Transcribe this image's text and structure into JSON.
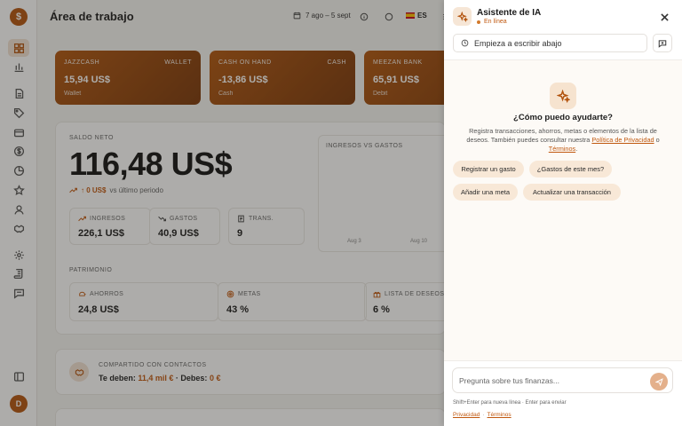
{
  "app": {
    "logo_glyph": "$",
    "page_title": "Área de trabajo",
    "user_initial": "D",
    "accent_color": "#b3540f"
  },
  "sidebar": {
    "items": [
      {
        "icon": "dashboard-icon",
        "active": true
      },
      {
        "icon": "bar-chart-icon"
      },
      {
        "icon": "document-icon"
      },
      {
        "icon": "tag-icon"
      },
      {
        "icon": "wallet-icon"
      },
      {
        "icon": "dollar-circle-icon"
      },
      {
        "icon": "pie-chart-icon"
      },
      {
        "icon": "star-icon"
      },
      {
        "icon": "user-icon"
      },
      {
        "icon": "handshake-icon"
      },
      {
        "icon": "settings-icon"
      },
      {
        "icon": "scroll-icon"
      },
      {
        "icon": "chat-icon"
      },
      {
        "icon": "collapse-sidebar-icon"
      }
    ]
  },
  "topbar": {
    "date_range": "7 ago – 5 sept",
    "language": "ES"
  },
  "accounts": [
    {
      "name": "JAZZCASH",
      "type": "WALLET",
      "amount": "15,94 US$",
      "subtype": "Wallet"
    },
    {
      "name": "CASH ON HAND",
      "type": "CASH",
      "amount": "-13,86 US$",
      "subtype": "Cash"
    },
    {
      "name": "MEEZAN BANK",
      "type": "",
      "amount": "65,91 US$",
      "subtype": "Debit"
    }
  ],
  "net": {
    "label": "SALDO NETO",
    "amount": "116,48 US$",
    "change_value": "↑ 0 US$",
    "change_text": "vs último periodo"
  },
  "stats": [
    {
      "label": "INGRESOS",
      "value": "226,1 US$",
      "icon": "trend-up-icon"
    },
    {
      "label": "GASTOS",
      "value": "40,9 US$",
      "icon": "trend-down-icon"
    },
    {
      "label": "TRANS.",
      "value": "9",
      "icon": "receipt-icon"
    }
  ],
  "income_chart": {
    "title": "INGRESOS VS GASTOS",
    "ticks": [
      "Aug 3",
      "Aug 10"
    ]
  },
  "patrimonio": {
    "label": "PATRIMONIO",
    "items": [
      {
        "label": "AHORROS",
        "value": "24,8 US$",
        "icon": "piggy-bank-icon"
      },
      {
        "label": "METAS",
        "value": "43 %",
        "icon": "target-icon"
      },
      {
        "label": "LISTA DE DESEOS",
        "value": "6 %",
        "icon": "gift-icon"
      }
    ]
  },
  "shared": {
    "title": "COMPARTIDO CON CONTACTOS",
    "owed_label": "Te deben:",
    "owed_value": "11,4 mil €",
    "debt_label": "· Debes:",
    "debt_value": "0 €"
  },
  "assistant": {
    "title": "Asistente de IA",
    "status": "En línea",
    "history_placeholder": "Empieza a escribir abajo",
    "help_title": "¿Cómo puedo ayudarte?",
    "help_text": "Registra transacciones, ahorros, metas o elementos de la lista de deseos. También puedes consultar nuestra",
    "privacy_link": "Política de Privacidad",
    "or_text": "o",
    "terms_link": "Términos",
    "period": ".",
    "chips": [
      "Registrar un gasto",
      "¿Gastos de este mes?",
      "Añadir una meta",
      "Actualizar una transacción"
    ],
    "input_placeholder": "Pregunta sobre tus finanzas...",
    "input_value": "",
    "hint": "Shift+Enter para nueva línea · Enter para enviar",
    "footer_privacy": "Privacidad",
    "footer_sep": "·",
    "footer_terms": "Términos"
  }
}
